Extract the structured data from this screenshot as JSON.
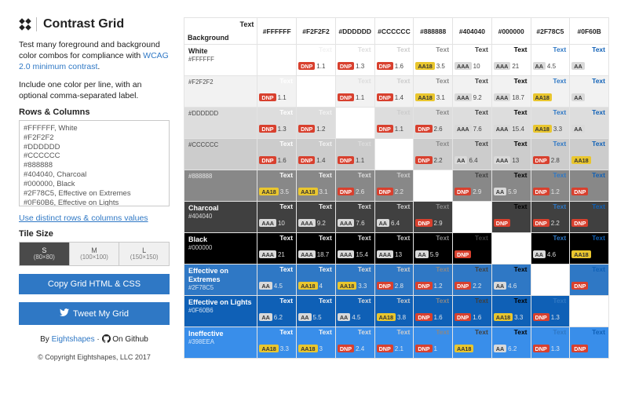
{
  "brand": {
    "title": "Contrast Grid"
  },
  "lead1": "Test many foreground and background color combos for compliance with ",
  "lead1_link": "WCAG 2.0 minimum contrast",
  "lead1_tail": ".",
  "lead2": "Include one color per line, with an optional comma-separated label.",
  "rows_columns_label": "Rows & Columns",
  "colors_input": "#FFFFFF, White\n#F2F2F2\n#DDDDDD\n#CCCCCC\n#888888\n#404040, Charcoal\n#000000, Black\n#2F78C5, Effective on Extremes\n#0F60B6, Effective on Lights\n#398EEA, Ineffective",
  "distinct_link": "Use distinct rows & columns values",
  "tilesize_label": "Tile Size",
  "tiles": [
    {
      "label": "S",
      "sub": "(80×80)"
    },
    {
      "label": "M",
      "sub": "(100×100)"
    },
    {
      "label": "L",
      "sub": "(150×150)"
    }
  ],
  "copy_btn": "Copy Grid HTML & CSS",
  "tweet_btn": "Tweet My Grid",
  "byline_pre": "By ",
  "byline_link": "Eightshapes",
  "byline_mid": "  ·  ",
  "byline_gh": "On Github",
  "copyright": "© Copyright Eightshapes, LLC 2017",
  "grid": {
    "corner_bg": "Background",
    "corner_txt": "Text",
    "text_sample": "Text",
    "columns": [
      {
        "code": "#FFFFFF",
        "hex": "#FFFFFF"
      },
      {
        "code": "#F2F2F2",
        "hex": "#F2F2F2"
      },
      {
        "code": "#DDDDDD",
        "hex": "#DDDDDD"
      },
      {
        "code": "#CCCCCC",
        "hex": "#CCCCCC"
      },
      {
        "code": "#888888",
        "hex": "#888888"
      },
      {
        "code": "#404040",
        "hex": "#404040"
      },
      {
        "code": "#000000",
        "hex": "#000000"
      },
      {
        "code": "#2F78C5",
        "hex": "#2F78C5"
      },
      {
        "code": "#0F60B",
        "hex": "#0F60B6"
      }
    ],
    "rows": [
      {
        "name": "White",
        "code": "#FFFFFF",
        "hex": "#FFFFFF"
      },
      {
        "name": "",
        "code": "#F2F2F2",
        "hex": "#F2F2F2"
      },
      {
        "name": "",
        "code": "#DDDDDD",
        "hex": "#DDDDDD"
      },
      {
        "name": "",
        "code": "#CCCCCC",
        "hex": "#CCCCCC"
      },
      {
        "name": "",
        "code": "#888888",
        "hex": "#888888"
      },
      {
        "name": "Charcoal",
        "code": "#404040",
        "hex": "#404040"
      },
      {
        "name": "Black",
        "code": "#000000",
        "hex": "#000000"
      },
      {
        "name": "Effective on Extremes",
        "code": "#2F78C5",
        "hex": "#2F78C5"
      },
      {
        "name": "Effective on Lights",
        "code": "#0F60B6",
        "hex": "#0F60B6"
      },
      {
        "name": "Ineffective",
        "code": "#398EEA",
        "hex": "#398EEA"
      }
    ],
    "cells": [
      [
        null,
        {
          "badge": "DNP",
          "r": "1.1"
        },
        {
          "badge": "DNP",
          "r": "1.3"
        },
        {
          "badge": "DNP",
          "r": "1.6"
        },
        {
          "badge": "AA18",
          "r": "3.5"
        },
        {
          "badge": "AAA",
          "r": "10"
        },
        {
          "badge": "AAA",
          "r": "21"
        },
        {
          "badge": "AA",
          "r": "4.5"
        },
        {
          "badge": "AA",
          "r": ""
        }
      ],
      [
        {
          "badge": "DNP",
          "r": "1.1"
        },
        null,
        {
          "badge": "DNP",
          "r": "1.1"
        },
        {
          "badge": "DNP",
          "r": "1.4"
        },
        {
          "badge": "AA18",
          "r": "3.1"
        },
        {
          "badge": "AAA",
          "r": "9.2"
        },
        {
          "badge": "AAA",
          "r": "18.7"
        },
        {
          "badge": "AA18",
          "r": ""
        },
        {
          "badge": "AA",
          "r": ""
        }
      ],
      [
        {
          "badge": "DNP",
          "r": "1.3"
        },
        {
          "badge": "DNP",
          "r": "1.2"
        },
        null,
        {
          "badge": "DNP",
          "r": "1.1"
        },
        {
          "badge": "DNP",
          "r": "2.6"
        },
        {
          "badge": "AAA",
          "r": "7.6"
        },
        {
          "badge": "AAA",
          "r": "15.4"
        },
        {
          "badge": "AA18",
          "r": "3.3"
        },
        {
          "badge": "AA",
          "r": ""
        }
      ],
      [
        {
          "badge": "DNP",
          "r": "1.6"
        },
        {
          "badge": "DNP",
          "r": "1.4"
        },
        {
          "badge": "DNP",
          "r": "1.1"
        },
        null,
        {
          "badge": "DNP",
          "r": "2.2"
        },
        {
          "badge": "AA",
          "r": "6.4"
        },
        {
          "badge": "AAA",
          "r": "13"
        },
        {
          "badge": "DNP",
          "r": "2.8"
        },
        {
          "badge": "AA18",
          "r": ""
        }
      ],
      [
        {
          "badge": "AA18",
          "r": "3.5"
        },
        {
          "badge": "AA18",
          "r": "3.1"
        },
        {
          "badge": "DNP",
          "r": "2.6"
        },
        {
          "badge": "DNP",
          "r": "2.2"
        },
        null,
        {
          "badge": "DNP",
          "r": "2.9"
        },
        {
          "badge": "AA",
          "r": "5.9"
        },
        {
          "badge": "DNP",
          "r": "1.2"
        },
        {
          "badge": "DNP",
          "r": ""
        }
      ],
      [
        {
          "badge": "AAA",
          "r": "10"
        },
        {
          "badge": "AAA",
          "r": "9.2"
        },
        {
          "badge": "AAA",
          "r": "7.6"
        },
        {
          "badge": "AA",
          "r": "6.4"
        },
        {
          "badge": "DNP",
          "r": "2.9"
        },
        null,
        {
          "badge": "DNP",
          "r": ""
        },
        {
          "badge": "DNP",
          "r": "2.2"
        },
        {
          "badge": "DNP",
          "r": ""
        }
      ],
      [
        {
          "badge": "AAA",
          "r": "21"
        },
        {
          "badge": "AAA",
          "r": "18.7"
        },
        {
          "badge": "AAA",
          "r": "15.4"
        },
        {
          "badge": "AAA",
          "r": "13"
        },
        {
          "badge": "AA",
          "r": "5.9"
        },
        {
          "badge": "DNP",
          "r": ""
        },
        null,
        {
          "badge": "AA",
          "r": "4.6"
        },
        {
          "badge": "AA18",
          "r": ""
        }
      ],
      [
        {
          "badge": "AA",
          "r": "4.5"
        },
        {
          "badge": "AA18",
          "r": "4"
        },
        {
          "badge": "AA18",
          "r": "3.3"
        },
        {
          "badge": "DNP",
          "r": "2.8"
        },
        {
          "badge": "DNP",
          "r": "1.2"
        },
        {
          "badge": "DNP",
          "r": "2.2"
        },
        {
          "badge": "AA",
          "r": "4.6"
        },
        null,
        {
          "badge": "DNP",
          "r": ""
        }
      ],
      [
        {
          "badge": "AA",
          "r": "6.2"
        },
        {
          "badge": "AA",
          "r": "5.5"
        },
        {
          "badge": "AA",
          "r": "4.5"
        },
        {
          "badge": "AA18",
          "r": "3.8"
        },
        {
          "badge": "DNP",
          "r": "1.6"
        },
        {
          "badge": "DNP",
          "r": "1.6"
        },
        {
          "badge": "AA18",
          "r": "3.3"
        },
        {
          "badge": "DNP",
          "r": "1.3"
        },
        null
      ],
      [
        {
          "badge": "AA18",
          "r": "3.3"
        },
        {
          "badge": "AA18",
          "r": "3"
        },
        {
          "badge": "DNP",
          "r": "2.4"
        },
        {
          "badge": "DNP",
          "r": "2.1"
        },
        {
          "badge": "DNP",
          "r": "1"
        },
        {
          "badge": "AA18",
          "r": ""
        },
        {
          "badge": "AA",
          "r": "6.2"
        },
        {
          "badge": "DNP",
          "r": "1.3"
        },
        {
          "badge": "DNP",
          "r": ""
        }
      ]
    ]
  },
  "badges": {
    "DNP": {
      "bg": "#D8402E",
      "fg": "#ffffff"
    },
    "AA18": {
      "bg": "#E9C62E",
      "fg": "#333333"
    },
    "AA": {
      "bg": "#d9d9d9",
      "fg": "#333333"
    },
    "AAA": {
      "bg": "#d9d9d9",
      "fg": "#333333"
    }
  }
}
